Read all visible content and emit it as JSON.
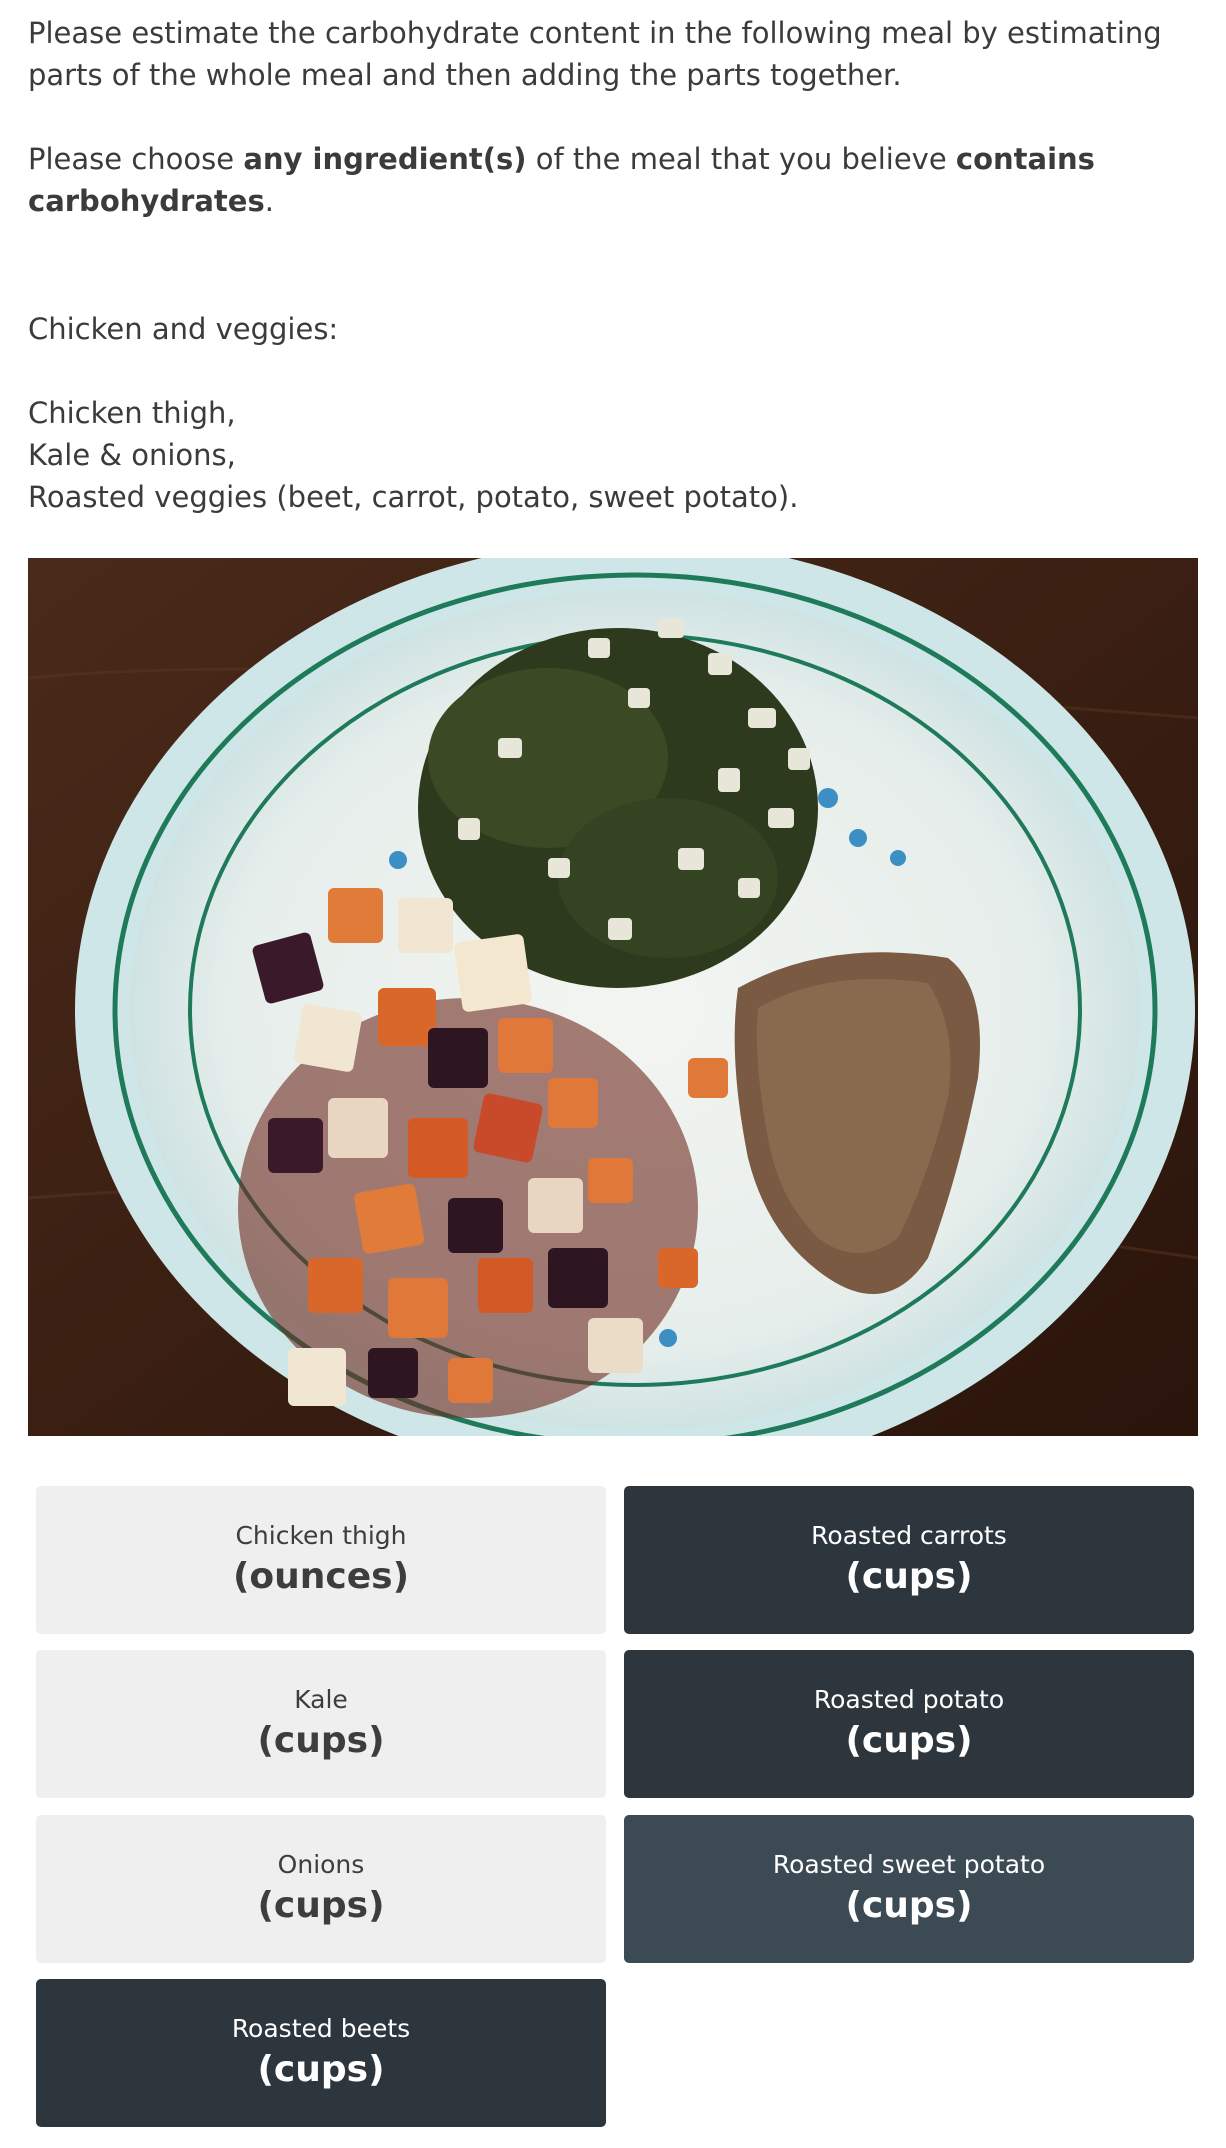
{
  "instructions": {
    "line1": "Please estimate the carbohydrate content in the following meal by estimating parts of the whole meal and then adding the parts together.",
    "line2_pre": "Please choose ",
    "line2_bold1": "any ingredient(s)",
    "line2_mid": " of the meal that you believe ",
    "line2_bold2": "contains carbohydrates",
    "line2_end": "."
  },
  "meal": {
    "heading": "Chicken and veggies:",
    "items": [
      "Chicken thigh,",
      "Kale & onions,",
      "Roasted veggies (beet, carrot, potato, sweet potato)."
    ]
  },
  "choices": [
    {
      "name": "Chicken thigh",
      "unit": "(ounces)",
      "selected": false
    },
    {
      "name": "Roasted carrots",
      "unit": "(cups)",
      "selected": true
    },
    {
      "name": "Kale",
      "unit": "(cups)",
      "selected": false
    },
    {
      "name": "Roasted potato",
      "unit": "(cups)",
      "selected": true
    },
    {
      "name": "Onions",
      "unit": "(cups)",
      "selected": false
    },
    {
      "name": "Roasted sweet potato",
      "unit": "(cups)",
      "selected": true
    },
    {
      "name": "Roasted beets",
      "unit": "(cups)",
      "selected": true
    }
  ],
  "colors": {
    "selected_bg": "#2d363d",
    "hover_bg": "#3c4a53",
    "unselected_bg": "#efefef",
    "text": "#3b3b3b"
  }
}
